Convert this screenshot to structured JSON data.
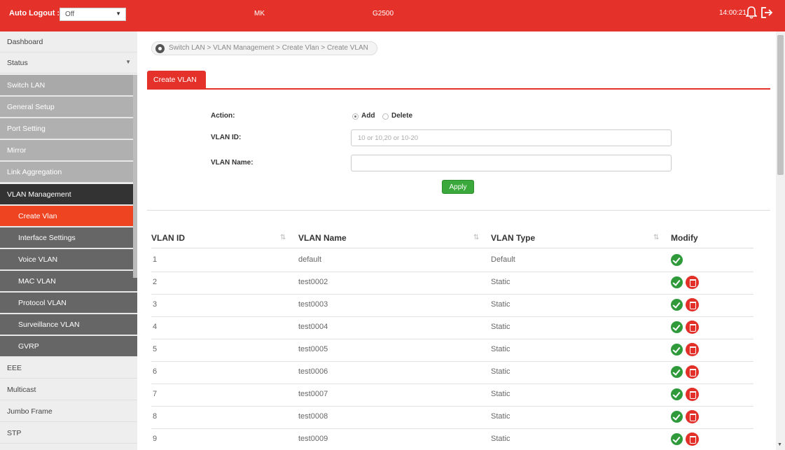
{
  "topbar": {
    "auto_logout_label": "Auto Logout :",
    "auto_logout_value": "Off",
    "model": "MK",
    "series": "G2500",
    "clock": "14:00:21"
  },
  "sidebar": {
    "items": [
      {
        "label": "Dashboard"
      },
      {
        "label": "Status"
      },
      {
        "label": "Switch LAN"
      },
      {
        "label": "General Setup"
      },
      {
        "label": "Port Setting"
      },
      {
        "label": "Mirror"
      },
      {
        "label": "Link Aggregation"
      },
      {
        "label": "VLAN Management"
      },
      {
        "label": "Create Vlan"
      },
      {
        "label": "Interface Settings"
      },
      {
        "label": "Voice VLAN"
      },
      {
        "label": "MAC VLAN"
      },
      {
        "label": "Protocol VLAN"
      },
      {
        "label": "Surveillance VLAN"
      },
      {
        "label": "GVRP"
      },
      {
        "label": "EEE"
      },
      {
        "label": "Multicast"
      },
      {
        "label": "Jumbo Frame"
      },
      {
        "label": "STP"
      }
    ]
  },
  "breadcrumb": "Switch LAN > VLAN Management > Create Vlan > Create VLAN",
  "tab": {
    "label": "Create VLAN"
  },
  "form": {
    "action_label": "Action:",
    "add_label": "Add",
    "delete_label": "Delete",
    "selected_action": "Add",
    "vlan_id_label": "VLAN ID:",
    "vlan_id_placeholder": "10 or 10,20 or 10-20",
    "vlan_id_value": "",
    "vlan_name_label": "VLAN Name:",
    "vlan_name_value": "",
    "apply_label": "Apply"
  },
  "table": {
    "headers": [
      "VLAN ID",
      "VLAN Name",
      "VLAN Type",
      "Modify"
    ],
    "rows": [
      {
        "id": "1",
        "name": "default",
        "type": "Default"
      },
      {
        "id": "2",
        "name": "test0002",
        "type": "Static"
      },
      {
        "id": "3",
        "name": "test0003",
        "type": "Static"
      },
      {
        "id": "4",
        "name": "test0004",
        "type": "Static"
      },
      {
        "id": "5",
        "name": "test0005",
        "type": "Static"
      },
      {
        "id": "6",
        "name": "test0006",
        "type": "Static"
      },
      {
        "id": "7",
        "name": "test0007",
        "type": "Static"
      },
      {
        "id": "8",
        "name": "test0008",
        "type": "Static"
      },
      {
        "id": "9",
        "name": "test0009",
        "type": "Static"
      }
    ]
  },
  "icons": {
    "edit": "check-circle-icon",
    "delete": "trash-icon",
    "bell": "bell-icon",
    "logout": "logout-icon"
  },
  "colors": {
    "brand_red": "#e4322b",
    "active_orange": "#ef4422",
    "apply_green": "#3aa83a"
  }
}
